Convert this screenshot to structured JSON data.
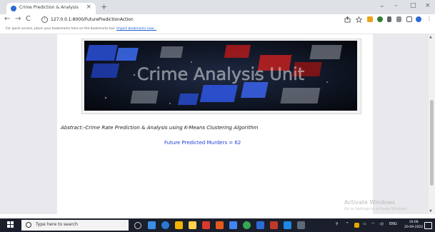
{
  "browser": {
    "tab_title": "Crime Prediction & Analysis",
    "tab_close": "×",
    "new_tab": "+",
    "url": "127.0.0.1:8000/FuturePredictionAction",
    "back": "←",
    "forward": "→",
    "reload": "C",
    "info": "i",
    "window_controls": {
      "chevron": "⌄",
      "minimize": "–",
      "maximize": "□",
      "close": "×"
    },
    "bookmarks_text": "For quick access, place your bookmarks here on the bookmarks bar.",
    "bookmarks_link": "Import bookmarks now..."
  },
  "page": {
    "banner_text": "Crime Analysis Unit",
    "abstract": "Abstract:-Crime Rate Prediction & Analysis using K-Means Clustering Algorithm",
    "result": "Future Predicted Murders = 62"
  },
  "watermark": {
    "title": "Activate Windows",
    "subtitle": "Go to Settings to activate Windows."
  },
  "taskbar": {
    "search_placeholder": "Type here to search",
    "tray_text": "ENG",
    "time": "16:08",
    "date": "20-09-2022"
  },
  "colors": {
    "accent": "#1c3fd6",
    "tab_strip": "#dee1e6",
    "taskbar": "#1b1f2b"
  }
}
